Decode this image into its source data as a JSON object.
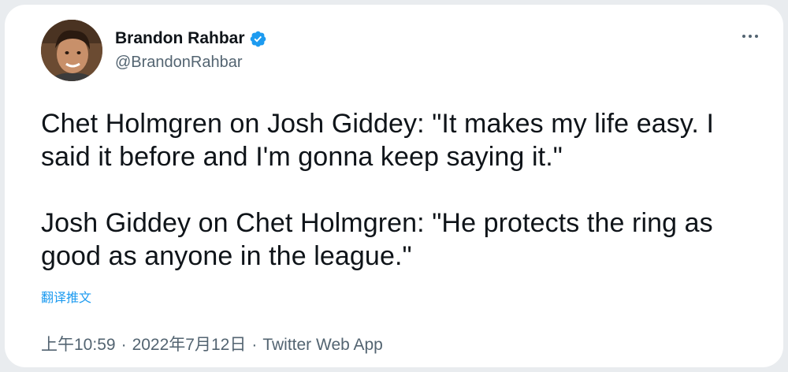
{
  "tweet": {
    "author": {
      "name": "Brandon Rahbar",
      "handle": "@BrandonRahbar",
      "verified": true
    },
    "paragraphs": [
      "Chet Holmgren on Josh Giddey: \"It makes my life easy. I said it before and I'm gonna keep saying it.\"",
      "Josh Giddey on Chet Holmgren: \"He protects the ring as good as anyone in the league.\""
    ],
    "translate_label": "翻译推文",
    "time": "上午10:59",
    "date": "2022年7月12日",
    "separator": "·",
    "source": "Twitter Web App"
  },
  "icons": {
    "verified": "verified-badge-icon",
    "more": "more-dots-icon"
  },
  "colors": {
    "accent": "#1d9bf0",
    "secondary_text": "#536471",
    "primary_text": "#0f1419"
  }
}
